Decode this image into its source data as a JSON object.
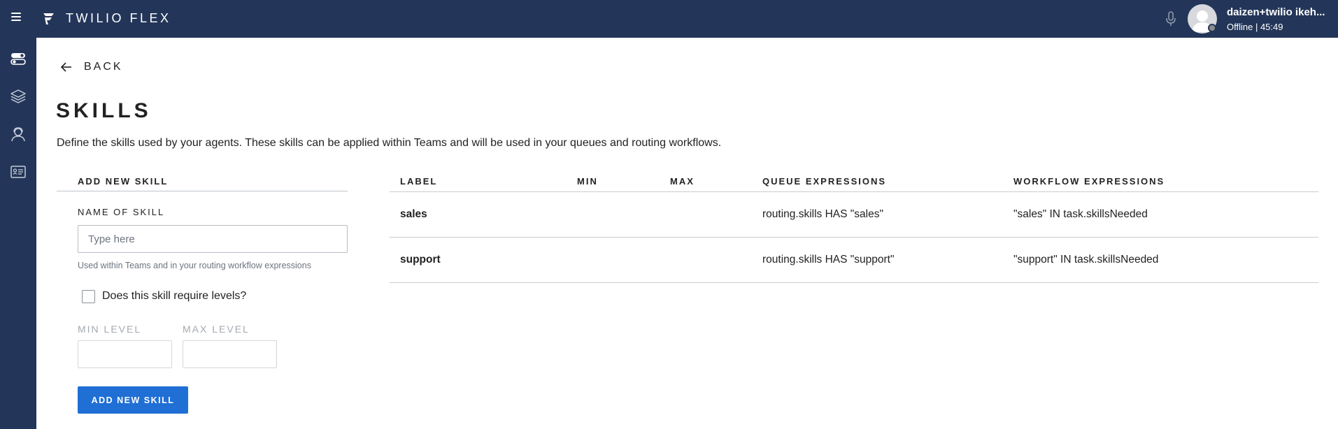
{
  "topbar": {
    "app_title": "TWILIO FLEX",
    "user_name": "daizen+twilio ikeh...",
    "user_status": "Offline | 45:49"
  },
  "sidebar": {
    "items": [
      {
        "icon": "toggles-icon"
      },
      {
        "icon": "layers-icon"
      },
      {
        "icon": "agents-icon"
      },
      {
        "icon": "skills-card-icon"
      }
    ]
  },
  "back_label": "BACK",
  "page": {
    "title": "SKILLS",
    "description": "Define the skills used by your agents. These skills can be applied within Teams and will be used in your queues and routing workflows."
  },
  "add_skill": {
    "heading": "ADD NEW SKILL",
    "name_label": "NAME OF SKILL",
    "name_placeholder": "Type here",
    "name_value": "",
    "hint": "Used within Teams and in your routing workflow expressions",
    "levels_checkbox_label": "Does this skill require levels?",
    "levels_checked": false,
    "min_level_label": "MIN LEVEL",
    "max_level_label": "MAX LEVEL",
    "button_label": "ADD NEW SKILL"
  },
  "table": {
    "headers": [
      "LABEL",
      "MIN",
      "MAX",
      "QUEUE EXPRESSIONS",
      "WORKFLOW EXPRESSIONS"
    ],
    "rows": [
      {
        "label": "sales",
        "min": "",
        "max": "",
        "queue": "routing.skills HAS \"sales\"",
        "workflow": "\"sales\" IN task.skillsNeeded"
      },
      {
        "label": "support",
        "min": "",
        "max": "",
        "queue": "routing.skills HAS \"support\"",
        "workflow": "\"support\" IN task.skillsNeeded"
      }
    ]
  },
  "colors": {
    "nav_bg": "#233659",
    "primary_button": "#1f6fd5"
  }
}
